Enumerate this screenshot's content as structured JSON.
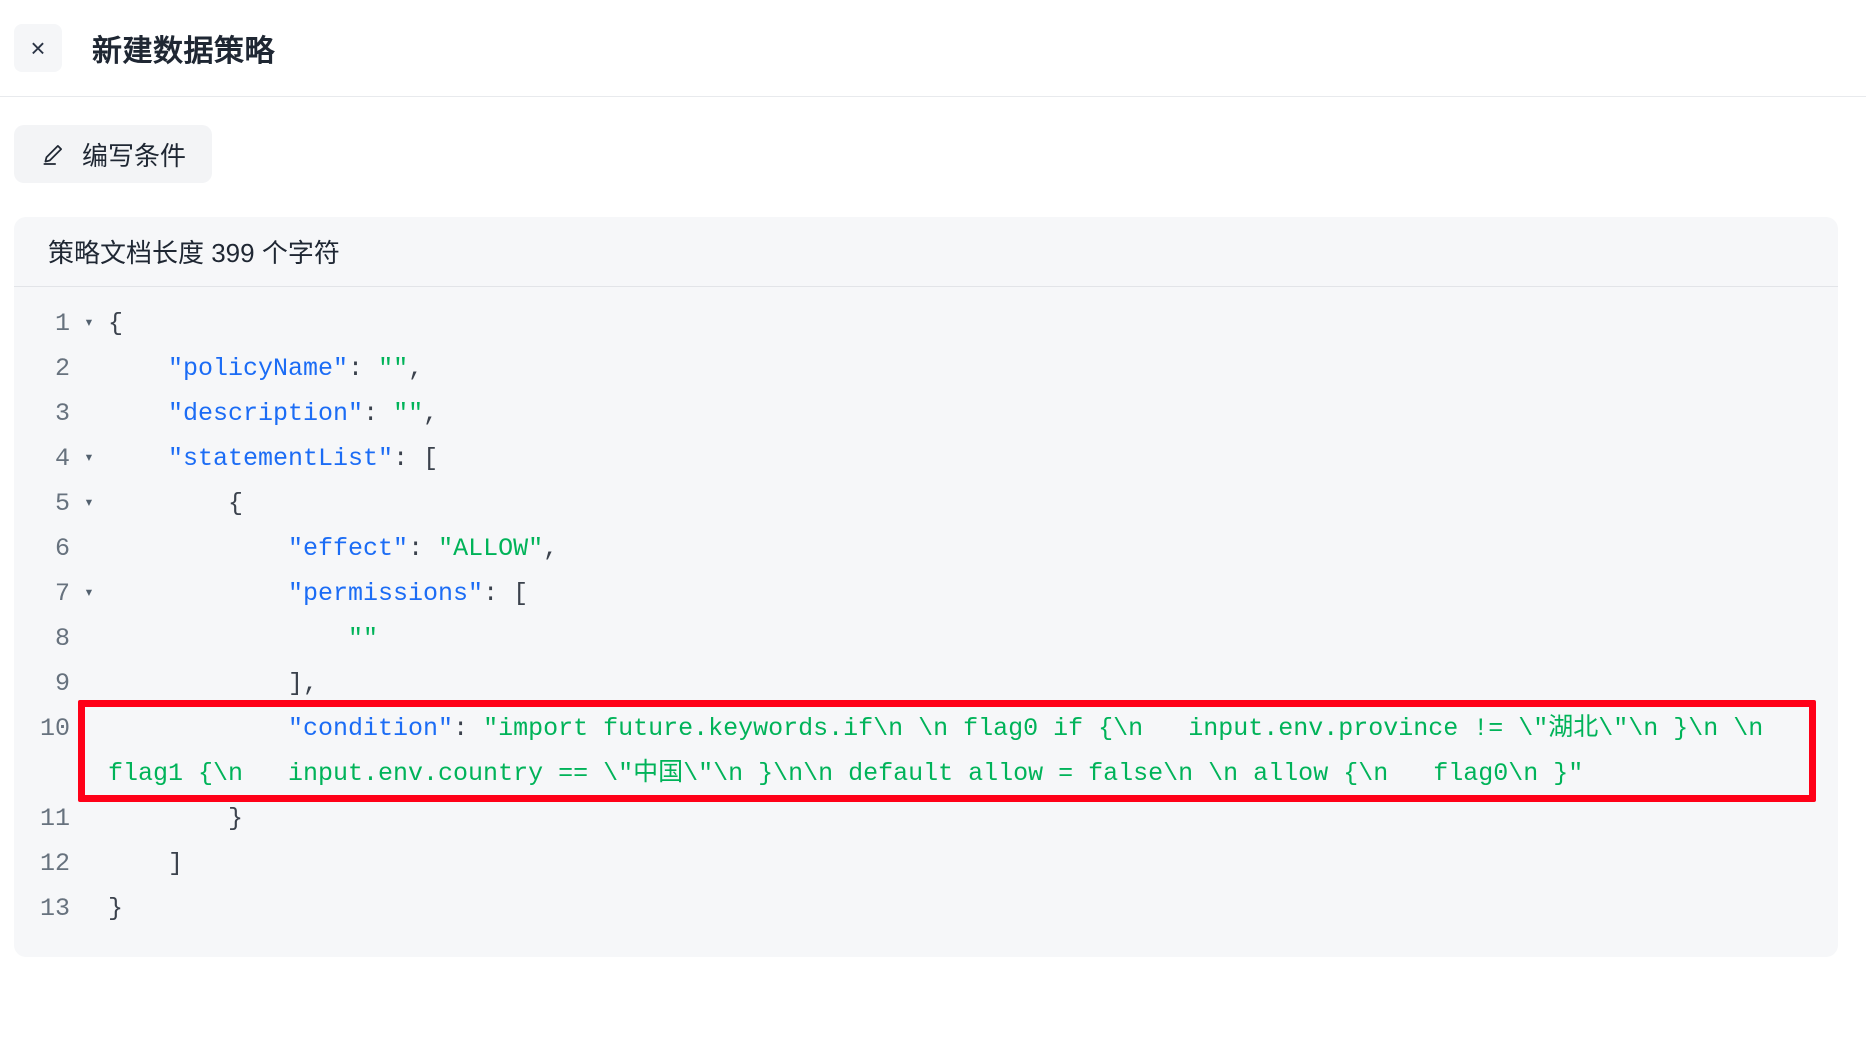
{
  "header": {
    "close_label": "×",
    "close_icon": "close-icon",
    "title": "新建数据策略"
  },
  "toolbar": {
    "edit_condition_label": "编写条件",
    "edit_condition_icon": "pencil-icon"
  },
  "code_panel": {
    "doc_length_label": "策略文档长度 399 个字符",
    "char_count": 399,
    "language": "json",
    "lines": [
      {
        "n": "1",
        "fold": "▾",
        "text": "{"
      },
      {
        "n": "2",
        "fold": "",
        "text": "    \"policyName\": \"\","
      },
      {
        "n": "3",
        "fold": "",
        "text": "    \"description\": \"\","
      },
      {
        "n": "4",
        "fold": "▾",
        "text": "    \"statementList\": ["
      },
      {
        "n": "5",
        "fold": "▾",
        "text": "        {"
      },
      {
        "n": "6",
        "fold": "",
        "text": "            \"effect\": \"ALLOW\","
      },
      {
        "n": "7",
        "fold": "▾",
        "text": "            \"permissions\": ["
      },
      {
        "n": "8",
        "fold": "",
        "text": "                \"\""
      },
      {
        "n": "9",
        "fold": "",
        "text": "            ],"
      },
      {
        "n": "10",
        "fold": "",
        "text": "            \"condition\": \"import future.keywords.if\\n \\n flag0 if {\\n   input.env.province != \\\"湖北\\\"\\n }\\n \\n flag1 {\\n   input.env.country == \\\"中国\\\"\\n }\\n\\n default allow = false\\n \\n allow {\\n   flag0\\n }\""
      },
      {
        "n": "11",
        "fold": "",
        "text": "        }"
      },
      {
        "n": "12",
        "fold": "",
        "text": "    ]"
      },
      {
        "n": "13",
        "fold": "",
        "text": "}"
      }
    ],
    "condition_value": "import future.keywords.if\\n \\n flag0 if {\\n   input.env.province != \\\"湖北\\\"\\n }\\n \\n flag1 {\\n   input.env.country == \\\"中国\\\"\\n }\\n\\n default allow = false\\n \\n allow {\\n   flag0\\n }"
  },
  "annotation": {
    "highlight_color": "#ff0018",
    "target": "condition-line"
  },
  "colors": {
    "panel_bg": "#f6f7f9",
    "key": "#1b6cf5",
    "string": "#00b359",
    "punctuation": "#3b424d",
    "line_number": "#67727e",
    "accent_red": "#ff0018"
  }
}
